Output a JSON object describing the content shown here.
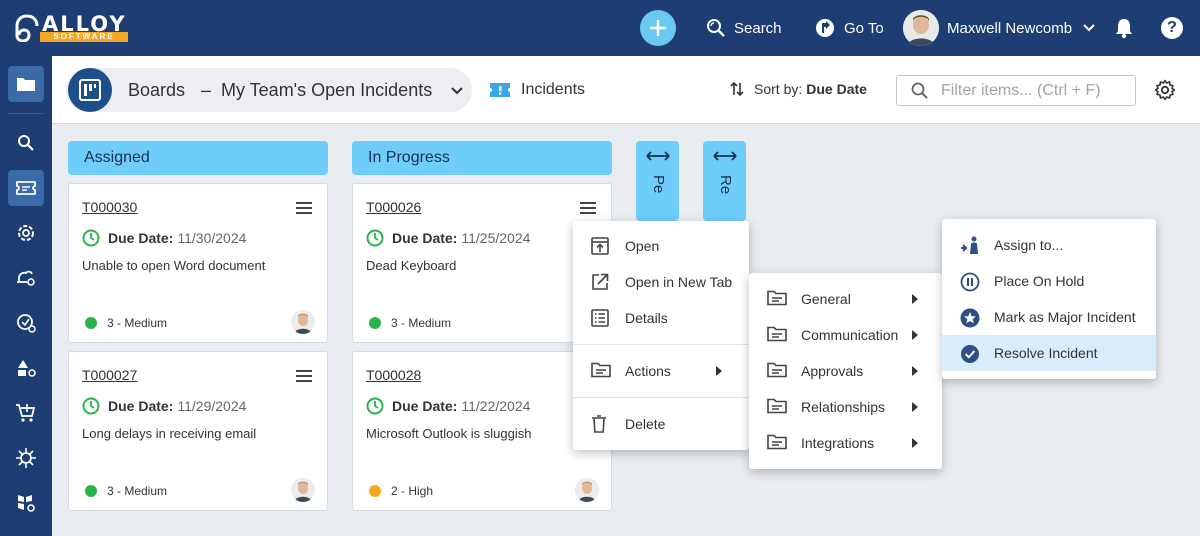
{
  "app": {
    "logo_primary": "ALLOY",
    "logo_secondary": "SOFTWARE"
  },
  "topbar": {
    "search_label": "Search",
    "goto_label": "Go To",
    "user_name": "Maxwell Newcomb"
  },
  "toolbar": {
    "board_label": "Boards",
    "board_dash": "–",
    "board_name": "My Team's Open Incidents",
    "object_label": "Incidents",
    "sort_label": "Sort by:",
    "sort_value": "Due Date",
    "filter_placeholder": "Filter items... (Ctrl + F)"
  },
  "columns": {
    "assigned": "Assigned",
    "in_progress": "In Progress",
    "collapsed_1": "Pe",
    "collapsed_2": "Re"
  },
  "cards": [
    {
      "ticket": "T000030",
      "due_label": "Due Date:",
      "due_date": "11/30/2024",
      "description": "Unable to open Word document",
      "priority": "3 - Medium",
      "priority_color": "#2bb24c"
    },
    {
      "ticket": "T000027",
      "due_label": "Due Date:",
      "due_date": "11/29/2024",
      "description": "Long delays in receiving email",
      "priority": "3 - Medium",
      "priority_color": "#2bb24c"
    },
    {
      "ticket": "T000026",
      "due_label": "Due Date:",
      "due_date": "11/25/2024",
      "description": "Dead Keyboard",
      "priority": "3 - Medium",
      "priority_color": "#2bb24c"
    },
    {
      "ticket": "T000028",
      "due_label": "Due Date:",
      "due_date": "11/22/2024",
      "description": "Microsoft Outlook is sluggish",
      "priority": "2 - High",
      "priority_color": "#f5a623"
    }
  ],
  "context_menu": {
    "open": "Open",
    "open_new_tab": "Open in New Tab",
    "details": "Details",
    "actions": "Actions",
    "delete": "Delete"
  },
  "actions_menu": {
    "general": "General",
    "communication": "Communication",
    "approvals": "Approvals",
    "relationships": "Relationships",
    "integrations": "Integrations"
  },
  "general_menu": {
    "assign_to": "Assign to...",
    "place_on_hold": "Place On Hold",
    "mark_major": "Mark as Major Incident",
    "resolve": "Resolve Incident"
  },
  "colors": {
    "nav_bg": "#1d3d73",
    "column_header": "#6fcdfb",
    "accent": "#6ac8f2",
    "highlight": "#d9ecfb"
  }
}
